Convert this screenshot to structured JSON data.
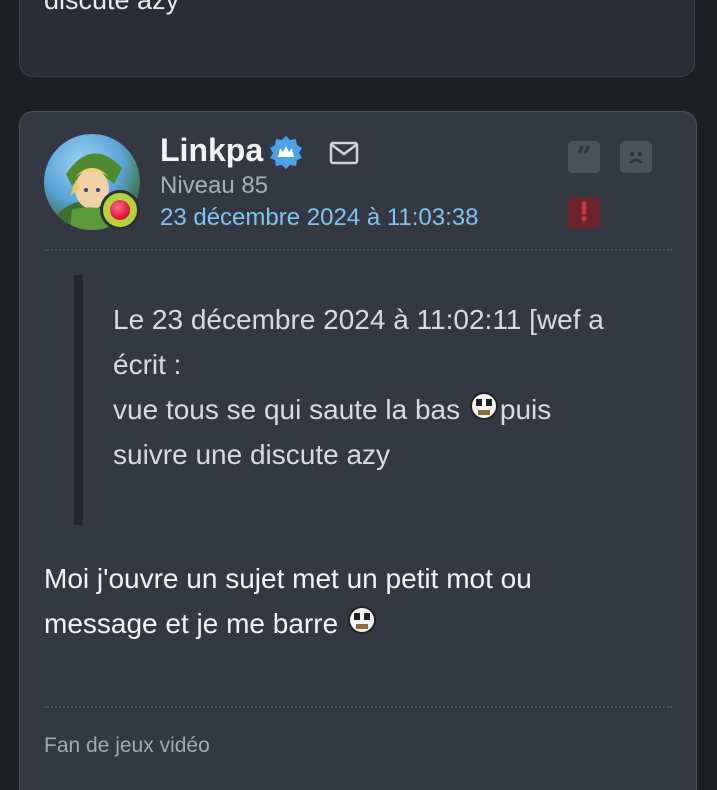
{
  "previous_post": {
    "text_tail": "discute azy"
  },
  "post": {
    "author": "Linkpa",
    "level": "Niveau 85",
    "date": "23 décembre 2024 à 11:03:38",
    "quote": {
      "header": "Le 23 décembre 2024 à 11:02:11 [wef a",
      "header_cont": "écrit :",
      "line1_a": "vue tous se qui saute la bas ",
      "line1_b": "puis",
      "line2": "suivre une discute azy"
    },
    "message": {
      "line1": "Moi j'ouvre un sujet met un petit mot ou",
      "line2": "message et je me barre "
    },
    "signature": "Fan de jeux vidéo",
    "actions": {
      "quote_glyph": "”",
      "report_glyph": "!"
    },
    "icons": {
      "verified": "verified-badge-icon",
      "mail": "mail-icon",
      "quote": "quote-icon",
      "sad": "sad-face-icon",
      "report": "report-icon",
      "smiley": "smiley-icon"
    },
    "colors": {
      "link": "#7fc3f0",
      "verified": "#4aa3e6",
      "report": "#c43a42"
    }
  }
}
